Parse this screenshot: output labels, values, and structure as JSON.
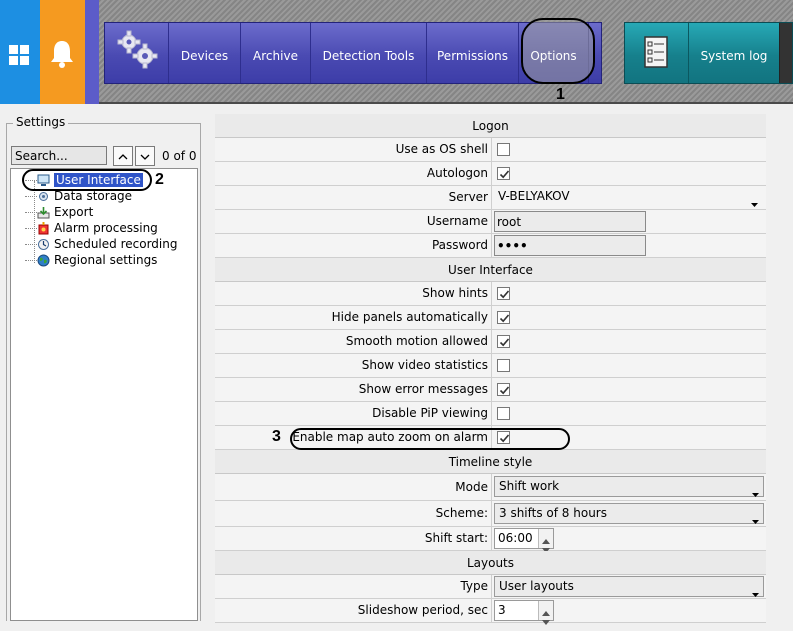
{
  "nav": {
    "tabs": [
      "Devices",
      "Archive",
      "Detection Tools",
      "Permissions",
      "Options"
    ],
    "system_log": "System log"
  },
  "annotations": {
    "one": "1",
    "two": "2",
    "three": "3"
  },
  "sidebar": {
    "title": "Settings",
    "search_value": "Search...",
    "count": "0 of 0",
    "items": [
      {
        "label": "User Interface",
        "icon": "monitor-icon"
      },
      {
        "label": "Data storage",
        "icon": "storage-gear-icon"
      },
      {
        "label": "Export",
        "icon": "export-arrow-icon"
      },
      {
        "label": "Alarm processing",
        "icon": "alarm-icon"
      },
      {
        "label": "Scheduled recording",
        "icon": "scheduled-recording-icon"
      },
      {
        "label": "Regional settings",
        "icon": "globe-icon"
      }
    ]
  },
  "sections": {
    "logon": "Logon",
    "user_interface": "User Interface",
    "timeline": "Timeline style",
    "layouts": "Layouts"
  },
  "logon": {
    "use_as_os_shell": {
      "label": "Use as OS shell",
      "checked": false
    },
    "autologon": {
      "label": "Autologon",
      "checked": true
    },
    "server": {
      "label": "Server",
      "value": "V-BELYAKOV"
    },
    "username": {
      "label": "Username",
      "value": "root"
    },
    "password": {
      "label": "Password",
      "value": "••••"
    }
  },
  "ui_options": [
    {
      "label": "Show hints",
      "checked": true
    },
    {
      "label": "Hide panels automatically",
      "checked": true
    },
    {
      "label": "Smooth motion allowed",
      "checked": true
    },
    {
      "label": "Show video statistics",
      "checked": false
    },
    {
      "label": "Show error messages",
      "checked": true
    },
    {
      "label": "Disable PiP viewing",
      "checked": false
    },
    {
      "label": "Enable map auto zoom on alarm",
      "checked": true
    }
  ],
  "timeline": {
    "mode": {
      "label": "Mode",
      "value": "Shift work"
    },
    "scheme": {
      "label": "Scheme:",
      "value": "3 shifts of 8 hours"
    },
    "shift_start": {
      "label": "Shift start:",
      "value": "06:00"
    }
  },
  "layouts": {
    "type": {
      "label": "Type",
      "value": "User layouts"
    },
    "slideshow": {
      "label": "Slideshow period, sec",
      "value": "3"
    }
  },
  "colors": {
    "nav_blue": "#4a4ab2",
    "nav_teal": "#16808c",
    "windows_tile": "#1d8fe2",
    "bell_tile": "#f59a20",
    "selection": "#2f54c8"
  }
}
